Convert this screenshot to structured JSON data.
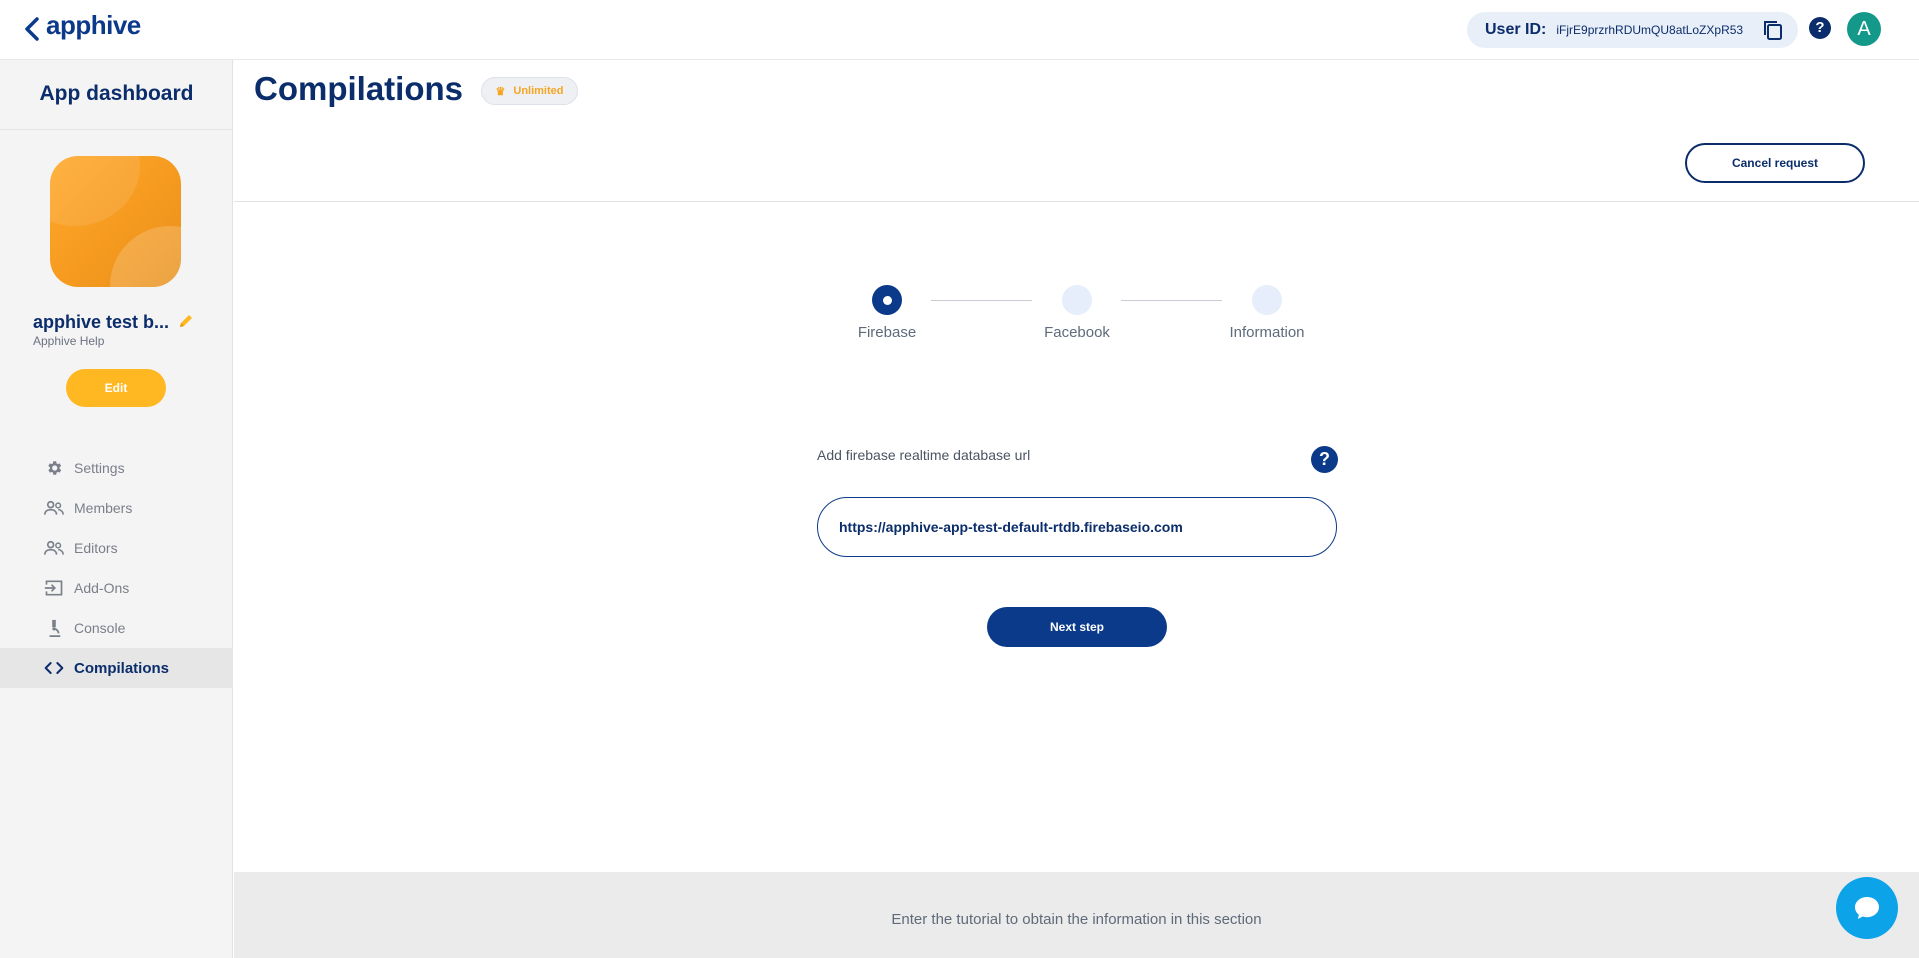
{
  "header": {
    "logo_text": "apphive",
    "user_id_label": "User ID:",
    "user_id_value": "iFjrE9przrhRDUmQU8atLoZXpR53",
    "avatar_letter": "A",
    "help_glyph": "?",
    "icons": [
      "back-chevron-icon",
      "copy-icon",
      "help-icon"
    ]
  },
  "sidebar": {
    "title": "App dashboard",
    "app_name": "apphive test b...",
    "app_owner": "Apphive Help",
    "edit_label": "Edit",
    "items": [
      {
        "label": "Settings",
        "icon": "gear-icon",
        "active": false
      },
      {
        "label": "Members",
        "icon": "people-icon",
        "active": false
      },
      {
        "label": "Editors",
        "icon": "people-icon",
        "active": false
      },
      {
        "label": "Add-Ons",
        "icon": "login-box-icon",
        "active": false
      },
      {
        "label": "Console",
        "icon": "microscope-icon",
        "active": false
      },
      {
        "label": "Compilations",
        "icon": "code-icon",
        "active": true
      }
    ]
  },
  "main": {
    "title": "Compilations",
    "plan_badge": "Unlimited",
    "cancel_label": "Cancel request",
    "steps": [
      {
        "label": "Firebase",
        "active": true
      },
      {
        "label": "Facebook",
        "active": false
      },
      {
        "label": "Information",
        "active": false
      }
    ],
    "field_label": "Add firebase realtime database url",
    "field_value": "https://apphive-app-test-default-rtdb.firebaseio.com",
    "next_label": "Next step"
  },
  "footer": {
    "text": "Enter the tutorial to obtain the information in this section"
  },
  "colors": {
    "brand_navy": "#0b2d6b",
    "accent_blue": "#0b3a8a",
    "edit_yellow": "#ffb821",
    "app_icon_orange": "#f59a1f",
    "chat_blue": "#0da3e8",
    "avatar_teal": "#13988a"
  }
}
